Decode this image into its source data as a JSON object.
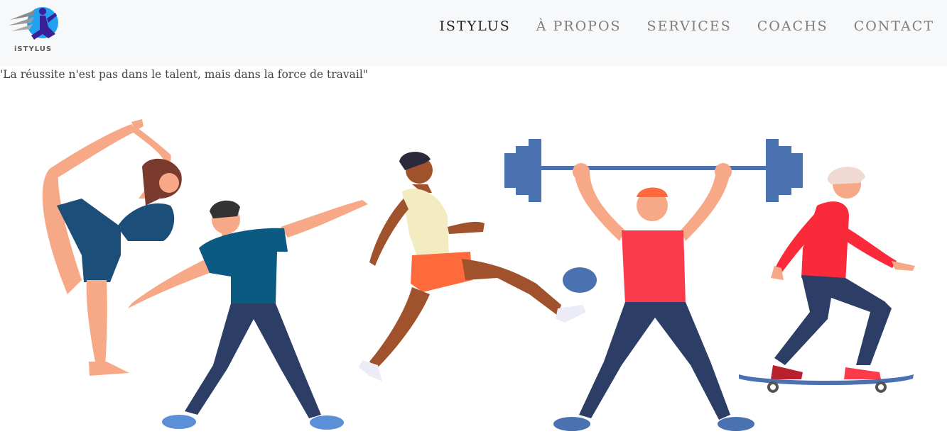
{
  "brand": {
    "logo_text": "iSTYLUS",
    "colors": {
      "runner": "#3a1f96",
      "swoosh": "#8a8a8a",
      "circle": "#1fa3f0"
    }
  },
  "nav": {
    "items": [
      {
        "label": "ISTYLUS",
        "active": true
      },
      {
        "label": "À PROPOS",
        "active": false
      },
      {
        "label": "SERVICES",
        "active": false
      },
      {
        "label": "COACHS",
        "active": false
      },
      {
        "label": "CONTACT",
        "active": false
      }
    ]
  },
  "hero": {
    "quote": "'La réussite n'est pas dans le talent, mais dans la force de travail\"",
    "illustration": "athletes-illustration",
    "figures": [
      "yoga-woman",
      "throwing-man",
      "kicking-runner",
      "weightlifter",
      "skateboarder"
    ],
    "colors": {
      "skin": "#f7a886",
      "dark_skin": "#a0522d",
      "navy": "#2d3e66",
      "teal": "#0a5a82",
      "blue": "#4a72b0",
      "red": "#fa3b4b",
      "yellow": "#f2ecc0",
      "orange": "#ff6a3d"
    }
  }
}
